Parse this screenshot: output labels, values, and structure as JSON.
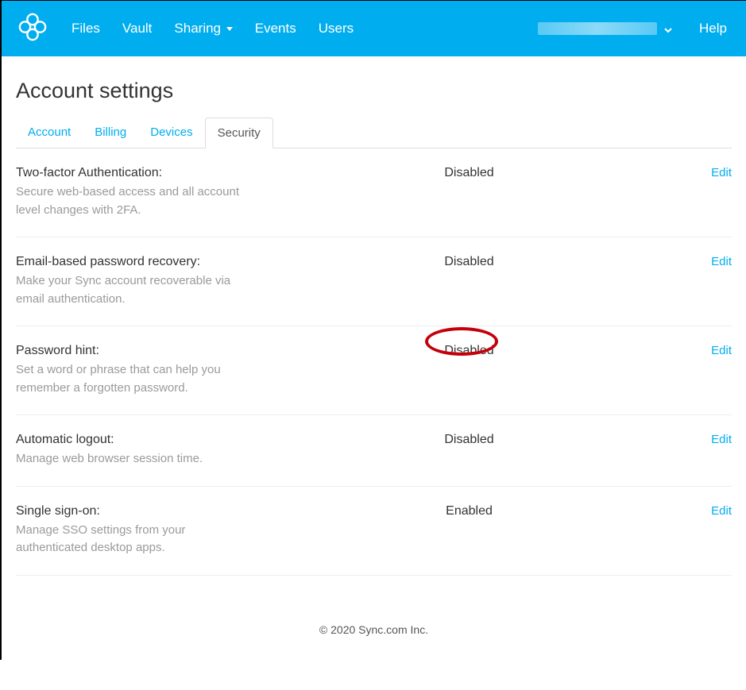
{
  "nav": {
    "files": "Files",
    "vault": "Vault",
    "sharing": "Sharing",
    "events": "Events",
    "users": "Users",
    "help": "Help"
  },
  "page_title": "Account settings",
  "tabs": {
    "account": "Account",
    "billing": "Billing",
    "devices": "Devices",
    "security": "Security"
  },
  "edit_label": "Edit",
  "sections": {
    "twofa": {
      "title": "Two-factor Authentication:",
      "desc": "Secure web-based access and all account level changes with 2FA.",
      "status": "Disabled"
    },
    "email_recovery": {
      "title": "Email-based password recovery:",
      "desc": "Make your Sync account recoverable via email authentication.",
      "status": "Disabled"
    },
    "pw_hint": {
      "title": "Password hint:",
      "desc": "Set a word or phrase that can help you remember a forgotten password.",
      "status": "Disabled"
    },
    "auto_logout": {
      "title": "Automatic logout:",
      "desc": "Manage web browser session time.",
      "status": "Disabled"
    },
    "sso": {
      "title": "Single sign-on:",
      "desc": "Manage SSO settings from your authenticated desktop apps.",
      "status": "Enabled"
    }
  },
  "footer": "© 2020 Sync.com Inc."
}
